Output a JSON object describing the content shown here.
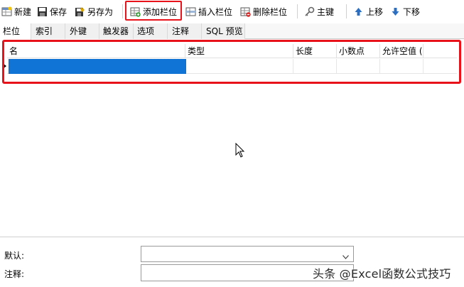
{
  "toolbar": {
    "new_label": "新建",
    "save_label": "保存",
    "save_as_label": "另存为",
    "add_field_label": "添加栏位",
    "insert_field_label": "插入栏位",
    "delete_field_label": "删除栏位",
    "primary_key_label": "主键",
    "move_up_label": "上移",
    "move_down_label": "下移"
  },
  "tabs": [
    {
      "label": "栏位",
      "active": true
    },
    {
      "label": "索引",
      "active": false
    },
    {
      "label": "外键",
      "active": false
    },
    {
      "label": "触发器",
      "active": false
    },
    {
      "label": "选项",
      "active": false
    },
    {
      "label": "注释",
      "active": false
    },
    {
      "label": "SQL 预览",
      "active": false
    }
  ],
  "grid": {
    "columns": [
      "名",
      "类型",
      "长度",
      "小数点",
      "允许空值 ("
    ],
    "rows": [
      {
        "name": "",
        "type": "",
        "length": "",
        "decimals": "",
        "allow_null": "",
        "selected": true
      }
    ]
  },
  "bottom": {
    "default_label": "默认:",
    "default_value": "",
    "comment_label": "注释:",
    "comment_value": ""
  },
  "watermark": "头条 @Excel函数公式技巧",
  "colors": {
    "highlight": "#e8121a",
    "selection": "#0f74d6"
  }
}
